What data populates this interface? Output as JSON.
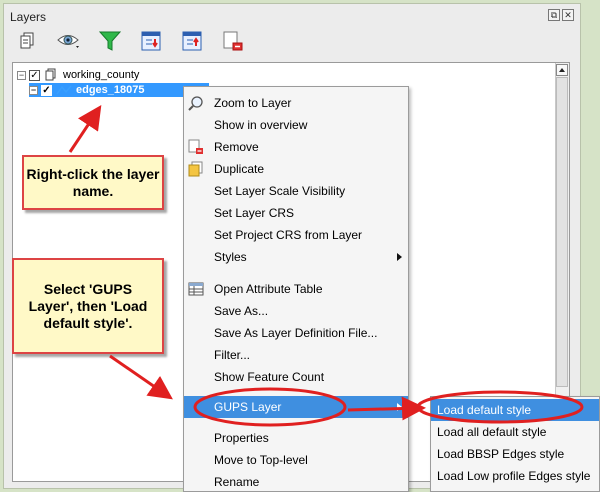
{
  "panel": {
    "title": "Layers",
    "controls": [
      "⧉",
      "✕"
    ]
  },
  "toolbar": {
    "buttons": [
      {
        "icon": "add-group-icon"
      },
      {
        "icon": "eye-visibility-icon"
      },
      {
        "icon": "filter-funnel-icon"
      },
      {
        "icon": "expand-all-icon"
      },
      {
        "icon": "collapse-all-icon"
      },
      {
        "icon": "remove-layer-icon"
      }
    ]
  },
  "tree": {
    "group": {
      "label": "working_county",
      "expander": "−",
      "checked": "✓"
    },
    "layer": {
      "label": "edges_18075",
      "expander": "−",
      "checked": "✓"
    }
  },
  "context_menu": {
    "items": [
      {
        "label": "Zoom to Layer",
        "icon": "zoom-icon"
      },
      {
        "label": "Show in overview"
      },
      {
        "label": "Remove",
        "icon": "remove-icon"
      },
      {
        "label": "Duplicate",
        "icon": "duplicate-icon"
      },
      {
        "label": "Set Layer Scale Visibility"
      },
      {
        "label": "Set Layer CRS"
      },
      {
        "label": "Set Project CRS from Layer"
      },
      {
        "label": "Styles",
        "submenu": true
      },
      {
        "label": "Open Attribute Table",
        "icon": "table-icon"
      },
      {
        "label": "Save As..."
      },
      {
        "label": "Save As Layer Definition File..."
      },
      {
        "label": "Filter..."
      },
      {
        "label": "Show Feature Count"
      },
      {
        "label": "GUPS Layer",
        "submenu": true,
        "highlighted": true
      },
      {
        "label": "Properties"
      },
      {
        "label": "Move to Top-level"
      },
      {
        "label": "Rename"
      }
    ]
  },
  "submenu": {
    "items": [
      {
        "label": "Load default style",
        "highlighted": true
      },
      {
        "label": "Load all default style"
      },
      {
        "label": "Load BBSP Edges style"
      },
      {
        "label": "Load Low profile Edges style"
      }
    ]
  },
  "callouts": {
    "right_click": "Right-click the layer name.",
    "select_gups": "Select 'GUPS Layer', then 'Load default style'."
  },
  "colors": {
    "selection": "#3399ff",
    "menu_highlight": "#3f8fe0",
    "annotation_red": "#e02020",
    "callout_fill": "#fff9c7",
    "page_background": "#d6e3c7"
  }
}
